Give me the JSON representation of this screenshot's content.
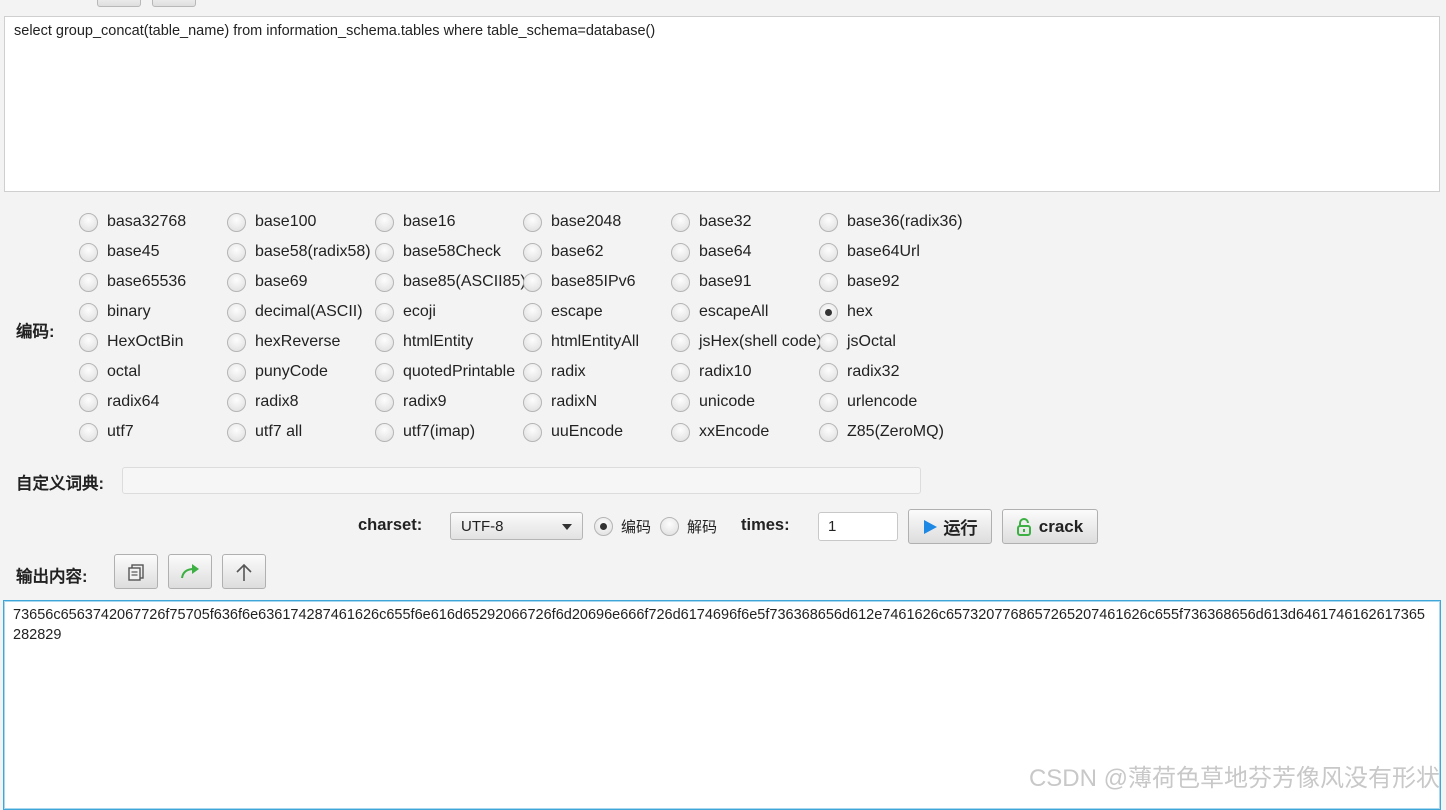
{
  "input": {
    "text": "select group_concat(table_name) from information_schema.tables where table_schema=database()"
  },
  "encoding": {
    "label": "编码:",
    "selected": "hex",
    "options": [
      "basa32768",
      "base100",
      "base16",
      "base2048",
      "base32",
      "base36(radix36)",
      "base45",
      "base58(radix58)",
      "base58Check",
      "base62",
      "base64",
      "base64Url",
      "base65536",
      "base69",
      "base85(ASCII85)",
      "base85IPv6",
      "base91",
      "base92",
      "binary",
      "decimal(ASCII)",
      "ecoji",
      "escape",
      "escapeAll",
      "hex",
      "HexOctBin",
      "hexReverse",
      "htmlEntity",
      "htmlEntityAll",
      "jsHex(shell code)",
      "jsOctal",
      "octal",
      "punyCode",
      "quotedPrintable",
      "radix",
      "radix10",
      "radix32",
      "radix64",
      "radix8",
      "radix9",
      "radixN",
      "unicode",
      "urlencode",
      "utf7",
      "utf7 all",
      "utf7(imap)",
      "uuEncode",
      "xxEncode",
      "Z85(ZeroMQ)"
    ]
  },
  "custom_dict": {
    "label": "自定义词典:",
    "value": ""
  },
  "controls": {
    "charset_label": "charset:",
    "charset_value": "UTF-8",
    "mode_encode": "编码",
    "mode_decode": "解码",
    "mode_selected": "encode",
    "times_label": "times:",
    "times_value": "1",
    "run_label": "运行",
    "crack_label": "crack"
  },
  "output": {
    "label": "输出内容:",
    "text": "73656c6563742067726f75705f636f6e636174287461626c655f6e616d65292066726f6d20696e666f726d6174696f6e5f736368656d612e7461626c6573207768657265207461626c655f736368656d613d6461746162617365282829"
  },
  "watermark": "CSDN @薄荷色草地芬芳像风没有形状",
  "colors": {
    "accent_blue": "#1e88e5",
    "crack_green": "#3cb043",
    "focus_border": "#3ea6d8"
  }
}
